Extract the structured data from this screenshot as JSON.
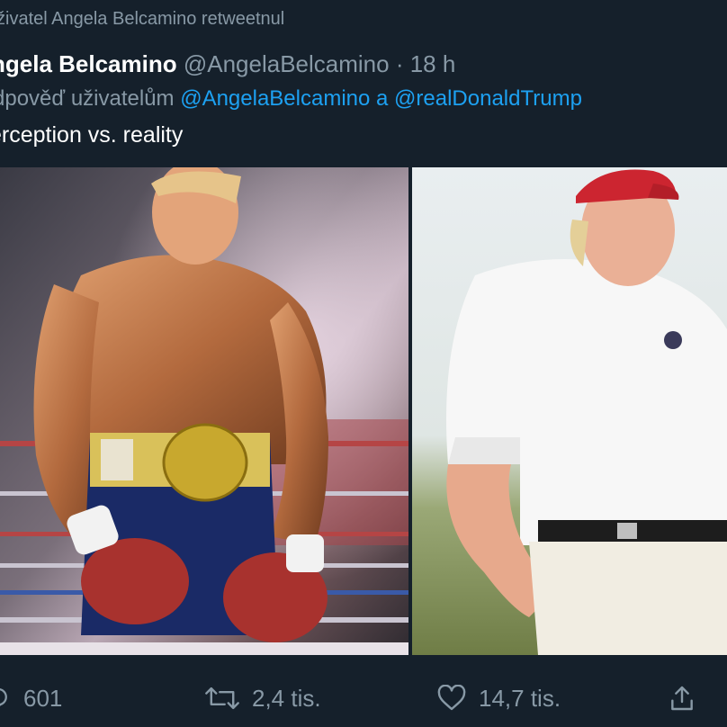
{
  "tweet": {
    "retweet_notice": "živatel Angela Belcamino retweetnul",
    "display_name": "ngela Belcamino",
    "handle": "@AngelaBelcamino",
    "separator": " · ",
    "time": "18 h",
    "reply_prefix": "dpověď uživatelům ",
    "reply_user1": "@AngelaBelcamino",
    "reply_and": " a ",
    "reply_user2": "@realDonaldTrump",
    "text": "erception vs. reality"
  },
  "actions": {
    "reply_count": "601",
    "retweet_count": "2,4 tis.",
    "like_count": "14,7 tis."
  },
  "icons": {
    "reply": "reply-icon",
    "retweet": "retweet-icon",
    "like": "heart-icon",
    "share": "share-icon"
  },
  "colors": {
    "background": "#15202b",
    "muted_text": "#8899a6",
    "link": "#1da1f2",
    "text": "#ffffff"
  }
}
